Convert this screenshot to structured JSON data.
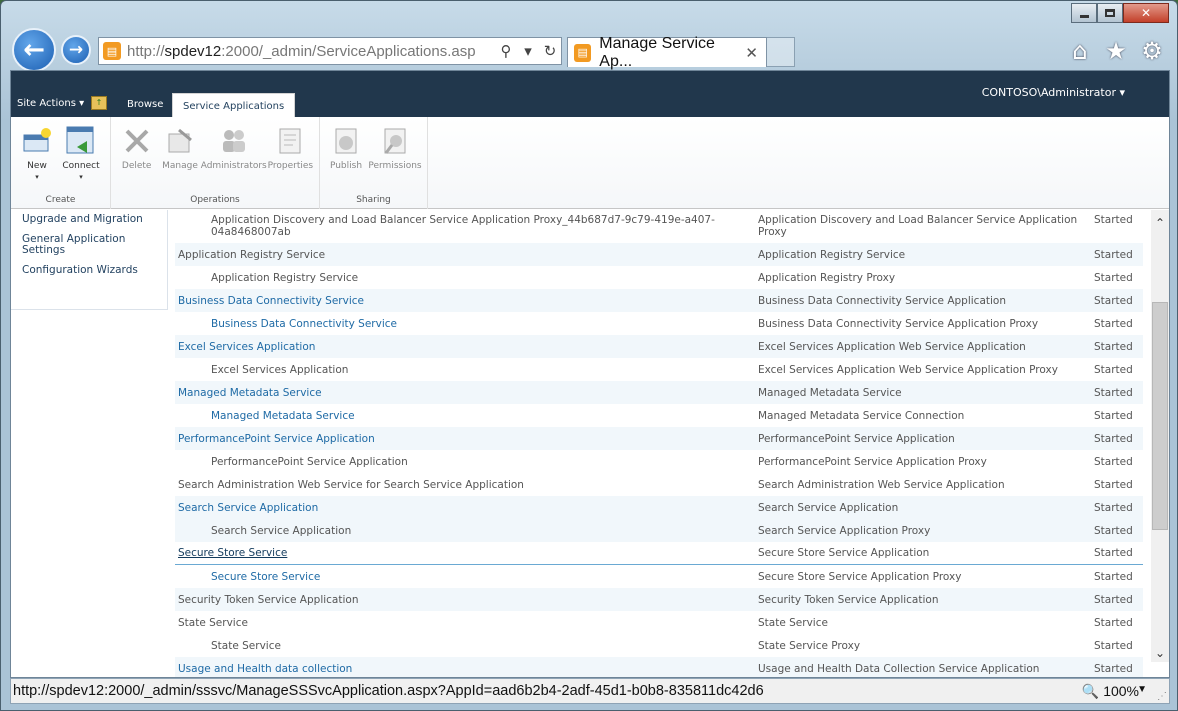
{
  "browser": {
    "address_url": "http://spdev12:2000/_admin/ServiceApplications.asp",
    "address_host": "spdev12",
    "tab_title": "Manage Service Ap...",
    "status_url": "http://spdev12:2000/_admin/sssvc/ManageSSSvcApplication.aspx?AppId=aad6b2b4-2adf-45d1-b0b8-835811dc42d6",
    "zoom": "100%"
  },
  "sp": {
    "site_actions": "Site Actions",
    "tab_browse": "Browse",
    "tab_service_apps": "Service Applications",
    "user": "CONTOSO\\Administrator"
  },
  "ribbon": {
    "groups": [
      {
        "label": "Create"
      },
      {
        "label": "Operations"
      },
      {
        "label": "Sharing"
      }
    ],
    "new": "New",
    "connect": "Connect",
    "delete": "Delete",
    "manage": "Manage",
    "administrators": "Administrators",
    "properties": "Properties",
    "publish": "Publish",
    "permissions": "Permissions"
  },
  "leftnav": [
    "Upgrade and Migration",
    "General Application Settings",
    "Configuration Wizards"
  ],
  "rows": [
    {
      "name": "Application Discovery and Load Balancer Service Application Proxy_44b687d7-9c79-419e-a407-04a8468007ab",
      "type": "Application Discovery and Load Balancer Service Application Proxy",
      "status": "Started"
    },
    {
      "name": "Application Registry Service",
      "type": "Application Registry Service",
      "status": "Started"
    },
    {
      "name": "Application Registry Service",
      "type": "Application Registry Proxy",
      "status": "Started"
    },
    {
      "name": "Business Data Connectivity Service",
      "type": "Business Data Connectivity Service Application",
      "status": "Started"
    },
    {
      "name": "Business Data Connectivity Service",
      "type": "Business Data Connectivity Service Application Proxy",
      "status": "Started"
    },
    {
      "name": "Excel Services Application",
      "type": "Excel Services Application Web Service Application",
      "status": "Started"
    },
    {
      "name": "Excel Services Application",
      "type": "Excel Services Application Web Service Application Proxy",
      "status": "Started"
    },
    {
      "name": "Managed Metadata Service",
      "type": "Managed Metadata Service",
      "status": "Started"
    },
    {
      "name": "Managed Metadata Service",
      "type": "Managed Metadata Service Connection",
      "status": "Started"
    },
    {
      "name": "PerformancePoint Service Application",
      "type": "PerformancePoint Service Application",
      "status": "Started"
    },
    {
      "name": "PerformancePoint Service Application",
      "type": "PerformancePoint Service Application Proxy",
      "status": "Started"
    },
    {
      "name": "Search Administration Web Service for Search Service Application",
      "type": "Search Administration Web Service Application",
      "status": "Started"
    },
    {
      "name": "Search Service Application",
      "type": "Search Service Application",
      "status": "Started"
    },
    {
      "name": "Search Service Application",
      "type": "Search Service Application Proxy",
      "status": "Started"
    },
    {
      "name": "Secure Store Service",
      "type": "Secure Store Service Application",
      "status": "Started"
    },
    {
      "name": "Secure Store Service",
      "type": "Secure Store Service Application Proxy",
      "status": "Started"
    },
    {
      "name": "Security Token Service Application",
      "type": "Security Token Service Application",
      "status": "Started"
    },
    {
      "name": "State Service",
      "type": "State Service",
      "status": "Started"
    },
    {
      "name": "State Service",
      "type": "State Service Proxy",
      "status": "Started"
    },
    {
      "name": "Usage and Health data collection",
      "type": "Usage and Health Data Collection Service Application",
      "status": "Started"
    }
  ]
}
